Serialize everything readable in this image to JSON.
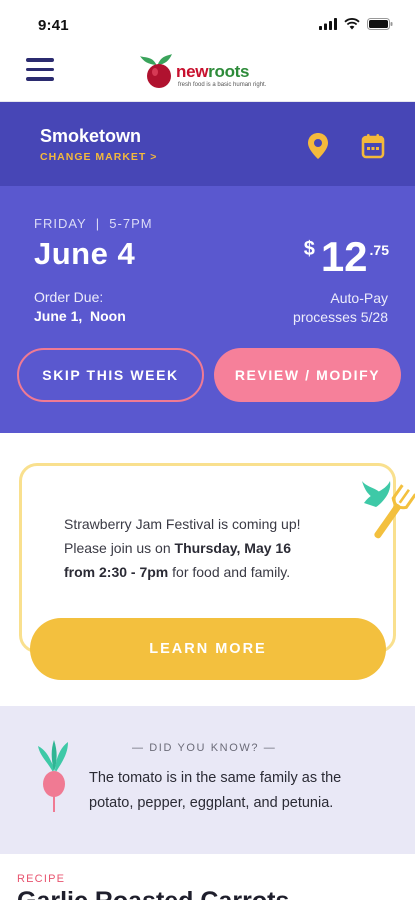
{
  "status_bar": {
    "time": "9:41"
  },
  "header": {
    "logo": {
      "word_new": "new",
      "word_roots": "roots",
      "tagline": "fresh food is a basic human right."
    }
  },
  "market": {
    "name": "Smoketown",
    "change_label": "CHANGE MARKET >"
  },
  "order": {
    "day_time": "FRIDAY  |  5-7PM",
    "date": "June 4",
    "due_label": "Order Due:",
    "due_value": "June 1,  Noon",
    "price_currency": "$",
    "price_whole": "12",
    "price_cents": ".75",
    "autopay_line1": "Auto-Pay",
    "autopay_line2": "processes 5/28",
    "skip_label": "SKIP THIS WEEK",
    "review_label": "REVIEW / MODIFY"
  },
  "event": {
    "line1": "Strawberry Jam Festival is coming up!",
    "line2_prefix": "Please join us on ",
    "line2_bold": "Thursday, May 16",
    "line3_bold": "from 2:30 - 7pm",
    "line3_suffix": " for food and family.",
    "button_label": "LEARN MORE"
  },
  "did_you_know": {
    "title": "—  DID YOU KNOW?  —",
    "body": "The tomato is in the same family as the potato, pepper, eggplant, and petunia."
  },
  "recipe": {
    "label": "RECIPE",
    "title": "Garlic Roasted Carrots"
  },
  "colors": {
    "market_bar": "#4746b6",
    "order_panel": "#5a58cf",
    "accent_pink": "#f6809a",
    "accent_yellow": "#f3c03e",
    "dyk_bg": "#e9e8f6"
  },
  "icons": [
    "hamburger-menu-icon",
    "location-pin-icon",
    "calendar-icon",
    "fork-icon",
    "radish-icon",
    "signal-icon",
    "wifi-icon",
    "battery-icon"
  ]
}
